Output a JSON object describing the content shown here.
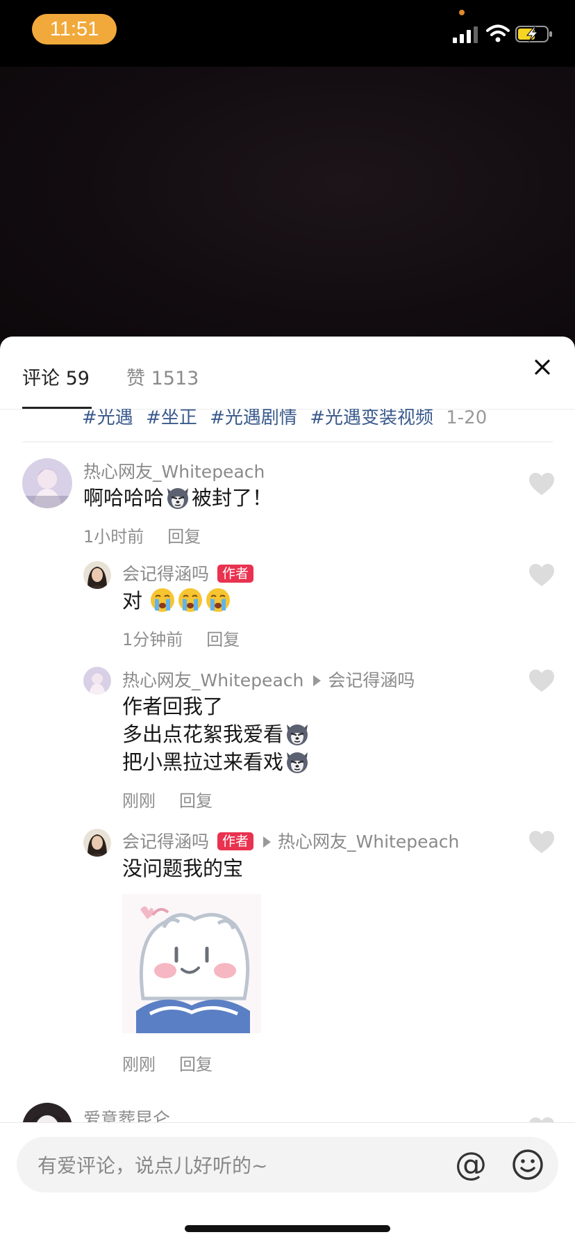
{
  "status_bar": {
    "time": "11:51",
    "icons": [
      "signal-icon",
      "wifi-icon",
      "battery-charging-icon"
    ]
  },
  "tabs": {
    "comments_label": "评论 59",
    "likes_label": "赞 1513",
    "active": "comments"
  },
  "hashtags": {
    "tags": [
      "#光遇",
      "#坐正",
      "#光遇剧情",
      "#光遇变装视频"
    ],
    "pager": "1-20"
  },
  "comments": [
    {
      "user": "热心网友_Whitepeach",
      "text_before_emoji": "啊哈哈哈",
      "emoji": "husky-emoji",
      "text_after_emoji": "被封了！",
      "time": "1小时前",
      "reply_label": "回复",
      "replies": [
        {
          "user": "会记得涵吗",
          "badge": "作者",
          "text": "对",
          "emojis": [
            "crying-emoji",
            "crying-emoji",
            "crying-emoji"
          ],
          "time": "1分钟前",
          "reply_label": "回复"
        },
        {
          "user": "热心网友_Whitepeach",
          "reply_to": "会记得涵吗",
          "lines": [
            "作者回我了",
            "多出点花絮我爱看",
            "把小黑拉过来看戏"
          ],
          "time": "刚刚",
          "reply_label": "回复"
        },
        {
          "user": "会记得涵吗",
          "badge": "作者",
          "reply_to": "热心网友_Whitepeach",
          "text": "没问题我的宝",
          "sticker": "bear-reading-sticker",
          "time": "刚刚",
          "reply_label": "回复"
        }
      ]
    },
    {
      "user": "爱意葬昆仑"
    }
  ],
  "input": {
    "placeholder": "有爱评论，说点儿好听的~",
    "at_label": "@"
  },
  "colors": {
    "accent_badge": "#e9324f",
    "time_pill": "#f2a93b",
    "hashtag": "#3a5a8c"
  }
}
